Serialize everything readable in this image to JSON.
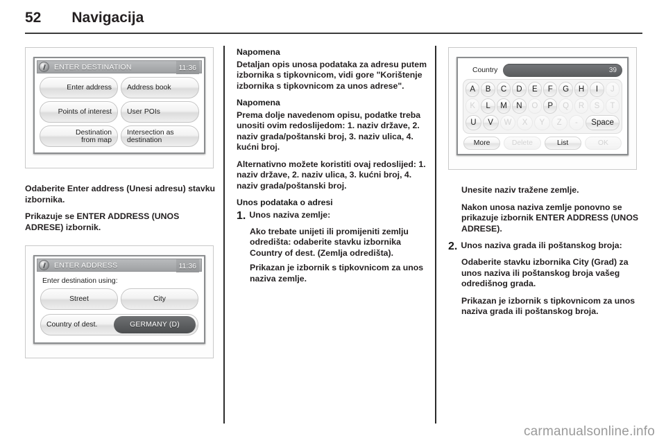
{
  "header": {
    "page_number": "52",
    "chapter": "Navigacija"
  },
  "footer": {
    "watermark": "carmanualsonline.info"
  },
  "screens": {
    "enter_destination": {
      "title": "ENTER DESTINATION",
      "clock": "11:36",
      "buttons": [
        {
          "label": "Enter address",
          "align": "right"
        },
        {
          "label": "Address book",
          "align": "left"
        },
        {
          "label": "Points of interest",
          "align": "right"
        },
        {
          "label": "User POIs",
          "align": "left"
        },
        {
          "label_line1": "Destination",
          "label_line2": "from map",
          "align": "right"
        },
        {
          "label_line1": "Intersection as",
          "label_line2": "destination",
          "align": "left"
        }
      ]
    },
    "enter_address": {
      "title": "ENTER ADDRESS",
      "clock": "11:36",
      "prompt": "Enter destination using:",
      "street_label": "Street",
      "city_label": "City",
      "country_label": "Country of dest.",
      "country_value": "GERMANY (D)"
    },
    "keyboard": {
      "field_label": "Country",
      "field_count": "39",
      "rows": [
        [
          {
            "k": "A",
            "dim": false
          },
          {
            "k": "B",
            "dim": false
          },
          {
            "k": "C",
            "dim": false
          },
          {
            "k": "D",
            "dim": false
          },
          {
            "k": "E",
            "dim": false
          },
          {
            "k": "F",
            "dim": false
          },
          {
            "k": "G",
            "dim": false
          },
          {
            "k": "H",
            "dim": false
          },
          {
            "k": "I",
            "dim": false
          },
          {
            "k": "J",
            "dim": true
          }
        ],
        [
          {
            "k": "K",
            "dim": true
          },
          {
            "k": "L",
            "dim": false
          },
          {
            "k": "M",
            "dim": false
          },
          {
            "k": "N",
            "dim": false
          },
          {
            "k": "O",
            "dim": true
          },
          {
            "k": "P",
            "dim": false
          },
          {
            "k": "Q",
            "dim": true
          },
          {
            "k": "R",
            "dim": true
          },
          {
            "k": "S",
            "dim": true
          },
          {
            "k": "T",
            "dim": true
          }
        ],
        [
          {
            "k": "U",
            "dim": false
          },
          {
            "k": "V",
            "dim": false
          },
          {
            "k": "W",
            "dim": true
          },
          {
            "k": "X",
            "dim": true
          },
          {
            "k": "Y",
            "dim": true
          },
          {
            "k": "Z",
            "dim": true
          },
          {
            "k": "-",
            "dim": true
          },
          {
            "k": "Space",
            "dim": false,
            "wide": true
          }
        ]
      ],
      "actions": [
        {
          "label": "More",
          "dim": false
        },
        {
          "label": "Delete",
          "dim": true
        },
        {
          "label": "List",
          "dim": false
        },
        {
          "label": "OK",
          "dim": true
        }
      ]
    }
  },
  "col1": {
    "p1": "Odaberite Enter address (Unesi adresu) stavku izbornika.",
    "p2": "Prikazuje se ENTER ADDRESS (UNOS ADRESE) izbornik."
  },
  "col2": {
    "note1_head": "Napomena",
    "note1_body": "Detaljan opis unosa podataka za adresu putem izbornika s tipkovnicom, vidi gore \"Korištenje izbornika s tipkovnicom za unos adrese\".",
    "note2_head": "Napomena",
    "note2_body": "Prema dolje navedenom opisu, podatke treba unositi ovim redoslijedom: 1. naziv države, 2. naziv grada/poštanski broj, 3. naziv ulica, 4. kućni broj.",
    "p3": "Alternativno možete koristiti ovaj redoslijed: 1. naziv države, 2. naziv ulica, 3. kućni broj, 4. naziv grada/poštanski broj.",
    "section_head": "Unos podataka o adresi",
    "item1_num": "1.",
    "item1_title": "Unos naziva zemlje:",
    "item1_p1": "Ako trebate unijeti ili promijeniti zemlju odredišta: odaberite stavku izbornika Country of dest. (Zemlja odredišta).",
    "item1_p2": "Prikazan je izbornik s tipkovnicom za unos naziva zemlje."
  },
  "col3": {
    "p1": "Unesite naziv tražene zemlje.",
    "p2": "Nakon unosa naziva zemlje ponovno se prikazuje izbornik ENTER ADDRESS (UNOS ADRESE).",
    "item2_num": "2.",
    "item2_title": "Unos naziva grada ili poštanskog broja:",
    "item2_p1": "Odaberite stavku izbornika City (Grad) za unos naziva ili poštanskog broja vašeg odredišnog grada.",
    "item2_p2": "Prikazan je izbornik s tipkovnicom za unos naziva grada ili poštanskog broja."
  }
}
